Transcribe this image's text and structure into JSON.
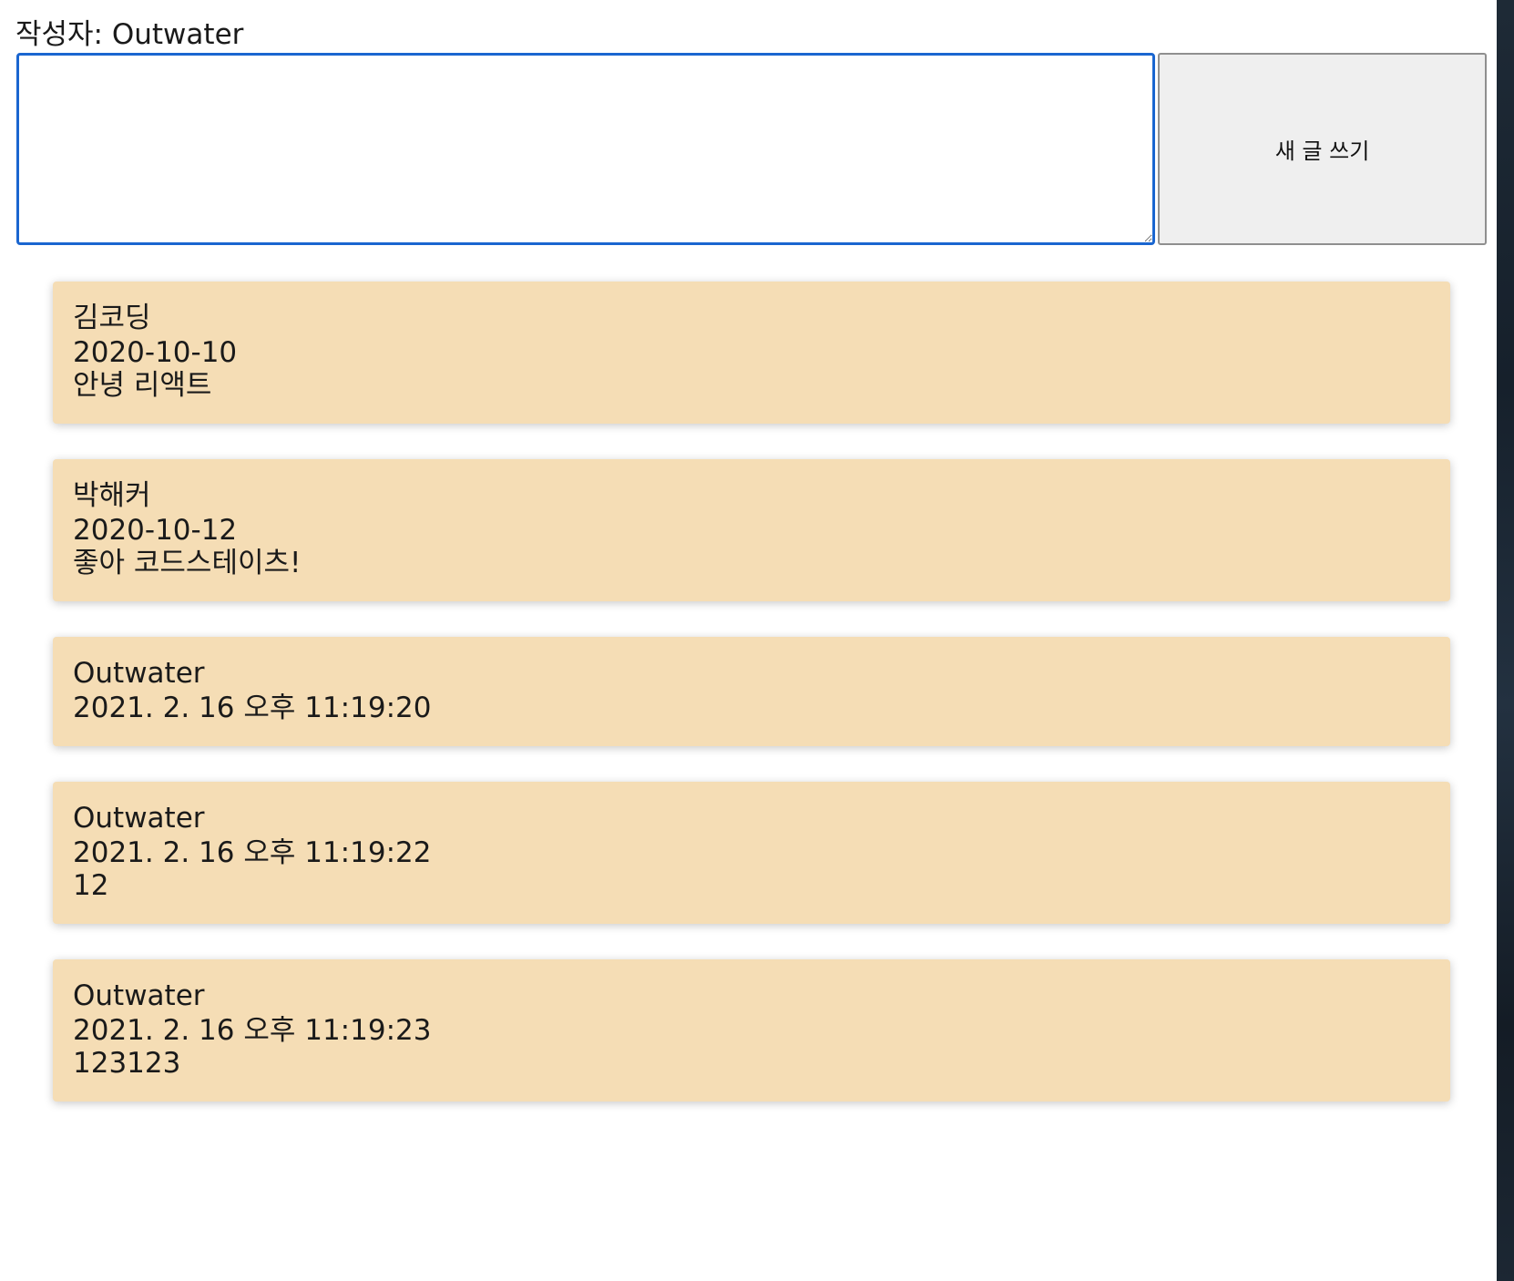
{
  "header": {
    "author_label": "작성자: Outwater"
  },
  "compose": {
    "textarea_value": "",
    "submit_label": "새 글 쓰기"
  },
  "tweets": [
    {
      "author": "김코딩",
      "date": "2020-10-10",
      "message": "안녕 리액트"
    },
    {
      "author": "박해커",
      "date": "2020-10-12",
      "message": "좋아 코드스테이츠!"
    },
    {
      "author": "Outwater",
      "date": "2021. 2. 16 오후 11:19:20",
      "message": ""
    },
    {
      "author": "Outwater",
      "date": "2021. 2. 16 오후 11:19:22",
      "message": "12"
    },
    {
      "author": "Outwater",
      "date": "2021. 2. 16 오후 11:19:23",
      "message": "123123"
    }
  ],
  "colors": {
    "card_background": "#f5ddb5",
    "input_focus_border": "#1a66d0",
    "button_background": "#efefef"
  }
}
